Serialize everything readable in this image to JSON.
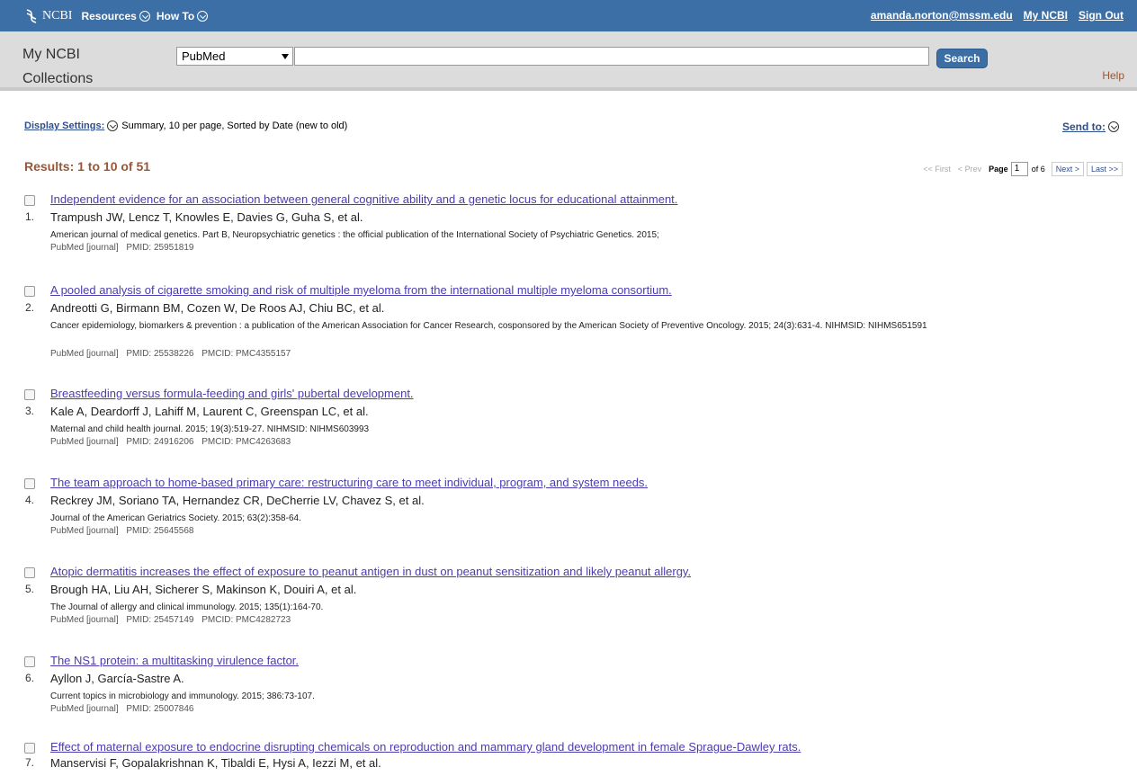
{
  "topbar": {
    "logo": "NCBI",
    "nav": [
      "Resources",
      "How To"
    ],
    "user_email": "amanda.norton@mssm.edu",
    "my_ncbi": "My NCBI",
    "sign_out": "Sign Out"
  },
  "search": {
    "collection_line1": "My NCBI",
    "collection_line2": "Collections",
    "database": "PubMed",
    "query": "",
    "button": "Search",
    "help": "Help"
  },
  "display": {
    "label": "Display Settings:",
    "summary": "Summary, 10 per page, Sorted by Date (new to old)",
    "send_to": "Send to:"
  },
  "results": {
    "header": "Results: 1 to 10 of 51",
    "pager": {
      "first": "<< First",
      "prev": "< Prev",
      "page_label": "Page",
      "page": "1",
      "of": "of 6",
      "next": "Next >",
      "last": "Last >>"
    },
    "items": [
      {
        "num": "1.",
        "title": "Independent evidence for an association between general cognitive ability and a genetic locus for educational attainment.",
        "authors": "Trampush JW, Lencz T, Knowles E, Davies G, Guha S, et al.",
        "source": "American journal of medical genetics. Part B, Neuropsychiatric genetics : the official publication of the International Society of Psychiatric Genetics. 2015;",
        "type": "PubMed [journal]",
        "pmid": "PMID: 25951819",
        "pmcid": ""
      },
      {
        "num": "2.",
        "title": "A pooled analysis of cigarette smoking and risk of multiple myeloma from the international multiple myeloma consortium.",
        "authors": "Andreotti G, Birmann BM, Cozen W, De Roos AJ, Chiu BC, et al.",
        "source": "Cancer epidemiology, biomarkers & prevention : a publication of the American Association for Cancer Research, cosponsored by the American Society of Preventive Oncology. 2015; 24(3):631-4. NIHMSID: NIHMS651591",
        "type": "PubMed [journal]",
        "pmid": "PMID: 25538226",
        "pmcid": "PMCID: PMC4355157"
      },
      {
        "num": "3.",
        "title": "Breastfeeding versus formula-feeding and girls' pubertal development.",
        "authors": "Kale A, Deardorff J, Lahiff M, Laurent C, Greenspan LC, et al.",
        "source": "Maternal and child health journal. 2015; 19(3):519-27. NIHMSID: NIHMS603993",
        "type": "PubMed [journal]",
        "pmid": "PMID: 24916206",
        "pmcid": "PMCID: PMC4263683"
      },
      {
        "num": "4.",
        "title": "The team approach to home-based primary care: restructuring care to meet individual, program, and system needs.",
        "authors": "Reckrey JM, Soriano TA, Hernandez CR, DeCherrie LV, Chavez S, et al.",
        "source": "Journal of the American Geriatrics Society. 2015; 63(2):358-64.",
        "type": "PubMed [journal]",
        "pmid": "PMID: 25645568",
        "pmcid": ""
      },
      {
        "num": "5.",
        "title": "Atopic dermatitis increases the effect of exposure to peanut antigen in dust on peanut sensitization and likely peanut allergy.",
        "authors": "Brough HA, Liu AH, Sicherer S, Makinson K, Douiri A, et al.",
        "source": "The Journal of allergy and clinical immunology. 2015; 135(1):164-70.",
        "type": "PubMed [journal]",
        "pmid": "PMID: 25457149",
        "pmcid": "PMCID: PMC4282723"
      },
      {
        "num": "6.",
        "title": "The NS1 protein: a multitasking virulence factor.",
        "authors": "Ayllon J, García-Sastre A.",
        "source": "Current topics in microbiology and immunology. 2015; 386:73-107.",
        "type": "PubMed [journal]",
        "pmid": "PMID: 25007846",
        "pmcid": ""
      },
      {
        "num": "7.",
        "title": "Effect of maternal exposure to endocrine disrupting chemicals on reproduction and mammary gland development in female Sprague-Dawley rats.",
        "authors": "Manservisi F, Gopalakrishnan K, Tibaldi E, Hysi A, Iezzi M, et al.",
        "source": "",
        "type": "",
        "pmid": "",
        "pmcid": ""
      }
    ]
  }
}
